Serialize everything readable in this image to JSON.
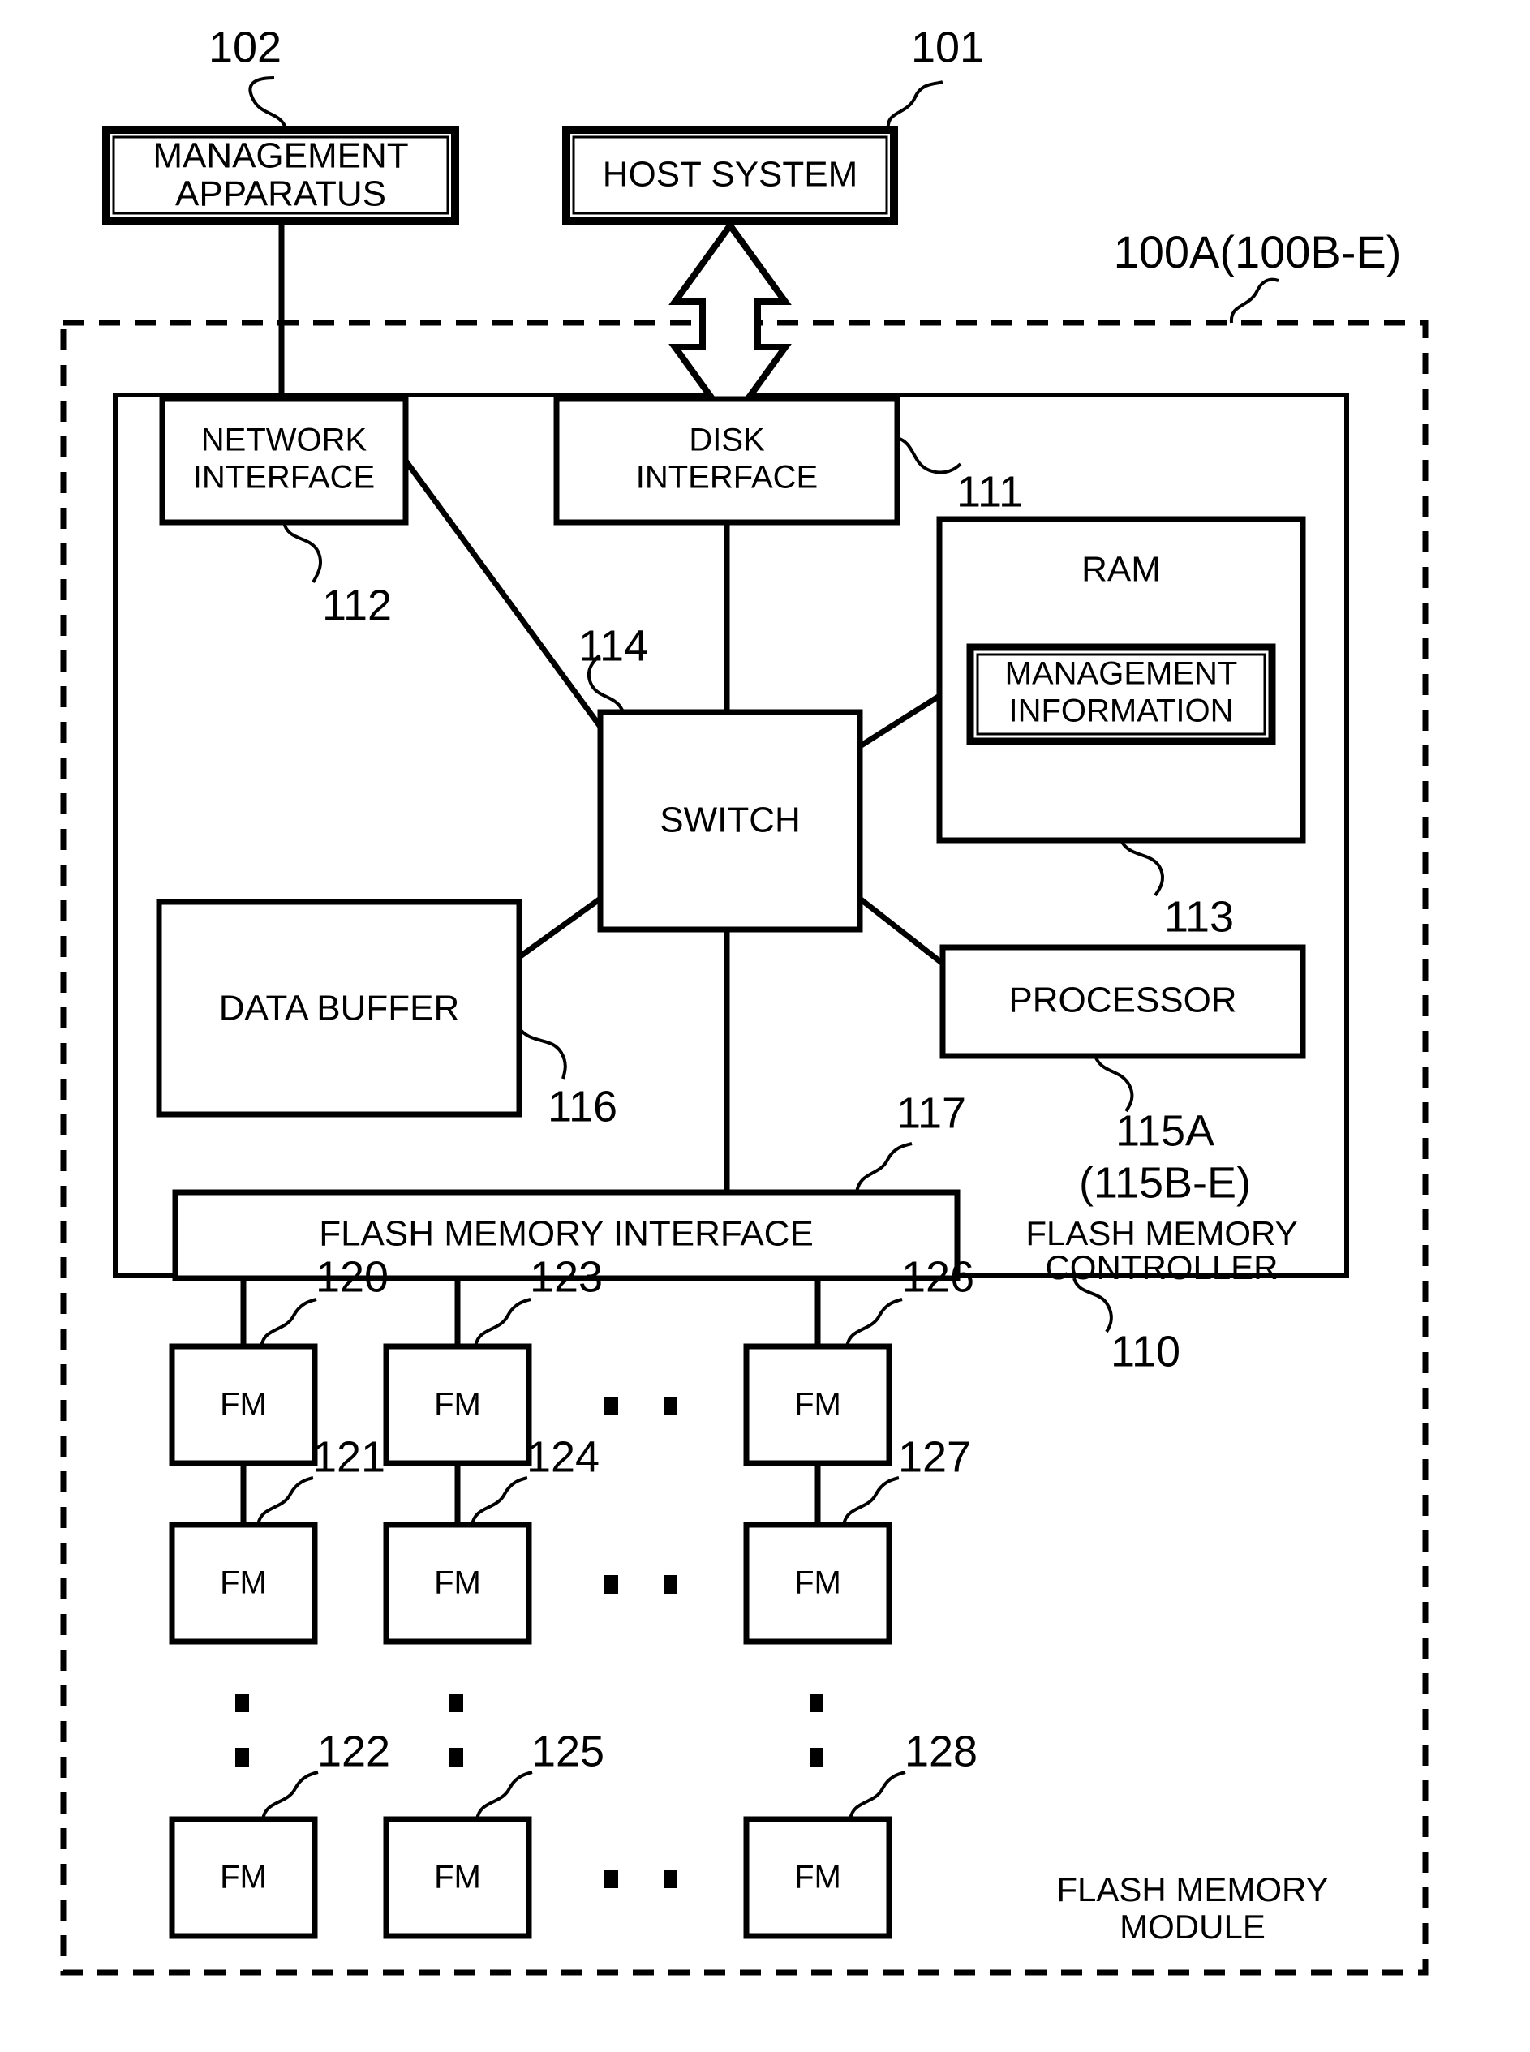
{
  "figure": {
    "type": "patent-block-diagram",
    "title_text": "",
    "background": "#ffffff",
    "line_color": "#000000"
  },
  "external": {
    "management_apparatus": {
      "label": "MANAGEMENT\nAPPARATUS",
      "line1": "MANAGEMENT",
      "line2": "APPARATUS",
      "ref": "102"
    },
    "host_system": {
      "label": "HOST SYSTEM",
      "ref": "101"
    }
  },
  "module": {
    "ref": "100A(100B-E)",
    "caption_line1": "FLASH MEMORY",
    "caption_line2": "MODULE"
  },
  "controller": {
    "ref": "110",
    "caption_line1": "FLASH MEMORY",
    "caption_line2": "CONTROLLER",
    "blocks": {
      "network_interface": {
        "line1": "NETWORK",
        "line2": "INTERFACE",
        "ref": "112"
      },
      "disk_interface": {
        "line1": "DISK",
        "line2": "INTERFACE",
        "ref": "111"
      },
      "ram": {
        "label": "RAM",
        "ref": "113"
      },
      "management_information": {
        "line1": "MANAGEMENT",
        "line2": "INFORMATION"
      },
      "switch": {
        "label": "SWITCH",
        "ref": "114"
      },
      "processor": {
        "label": "PROCESSOR",
        "ref": "115A",
        "ref_alt": "(115B-E)"
      },
      "data_buffer": {
        "label": "DATA BUFFER",
        "ref": "116"
      },
      "flash_memory_interface": {
        "label": "FLASH MEMORY INTERFACE",
        "ref": "117"
      }
    }
  },
  "flash_memory": {
    "cell_label": "FM",
    "columns": [
      {
        "refs": [
          "120",
          "121",
          "122"
        ]
      },
      {
        "refs": [
          "123",
          "124",
          "125"
        ]
      },
      {
        "refs": [
          "126",
          "127",
          "128"
        ]
      }
    ],
    "ellipsis_symbol": "."
  }
}
